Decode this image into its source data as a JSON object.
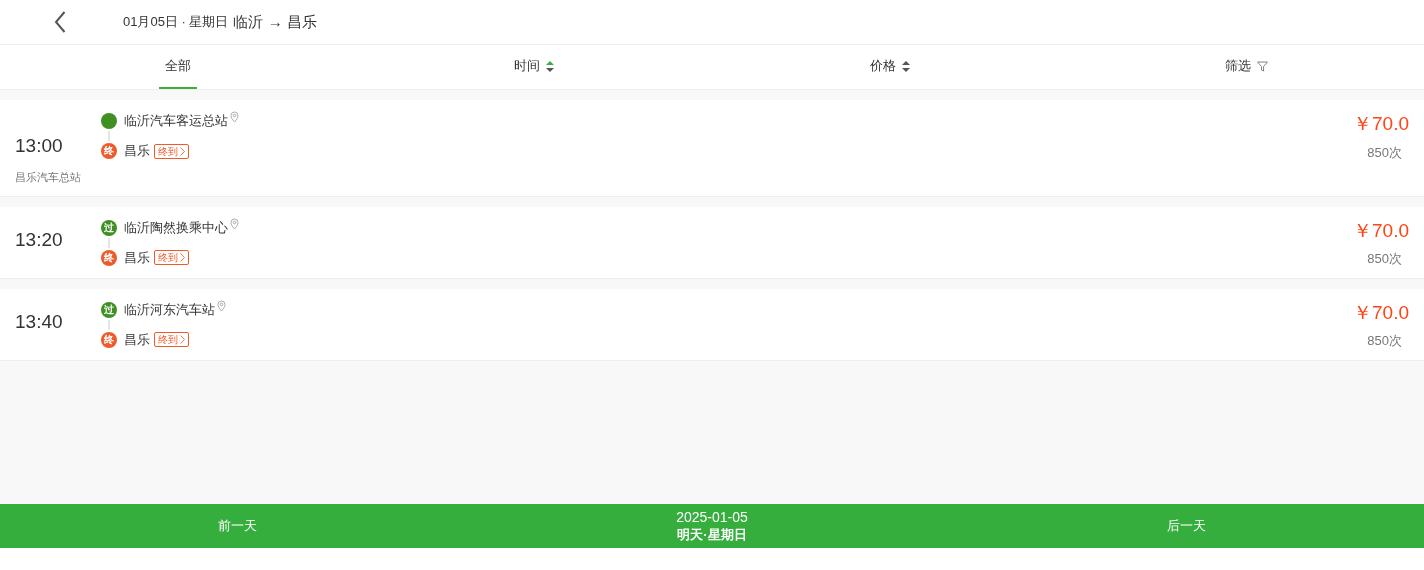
{
  "header": {
    "date": "01月05日 · 星期日",
    "route": "临沂 → 昌乐"
  },
  "tabs": [
    {
      "label": "全部",
      "kind": "plain",
      "selected": true
    },
    {
      "label": "时间",
      "kind": "sort",
      "selected": false,
      "ascending": true
    },
    {
      "label": "价格",
      "kind": "sort",
      "selected": false,
      "ascending": false
    },
    {
      "label": "筛选",
      "kind": "filter",
      "selected": false
    }
  ],
  "trips": [
    {
      "time": "13:00",
      "from": {
        "kind": "start",
        "name": "临沂汽车客运总站"
      },
      "to": {
        "badge": "终",
        "name": "昌乐",
        "tag": "终到"
      },
      "note": "昌乐汽车总站",
      "price": "￥70.0",
      "count": "850次"
    },
    {
      "time": "13:20",
      "from": {
        "kind": "pass",
        "badge": "过",
        "name": "临沂陶然换乘中心"
      },
      "to": {
        "badge": "终",
        "name": "昌乐",
        "tag": "终到"
      },
      "price": "￥70.0",
      "count": "850次"
    },
    {
      "time": "13:40",
      "from": {
        "kind": "pass",
        "badge": "过",
        "name": "临沂河东汽车站"
      },
      "to": {
        "badge": "终",
        "name": "昌乐",
        "tag": "终到"
      },
      "price": "￥70.0",
      "count": "850次"
    }
  ],
  "footer": {
    "prev": "前一天",
    "date": "2025-01-05",
    "day": "明天·星期日",
    "next": "后一天"
  }
}
